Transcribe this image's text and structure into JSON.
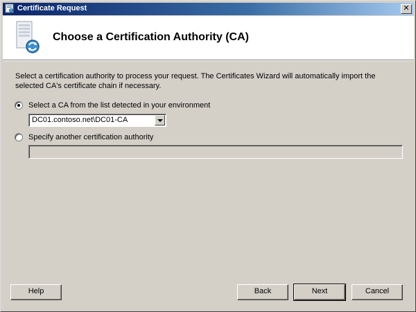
{
  "window": {
    "title": "Certificate Request",
    "close_glyph": "✕"
  },
  "header": {
    "title": "Choose a Certification Authority (CA)"
  },
  "intro_text": "Select a certification authority to process your request. The Certificates Wizard will automatically import the selected CA's certificate chain if necessary.",
  "options": {
    "detected": {
      "label": "Select a CA from the list detected in your environment",
      "selected": true,
      "ca_value": "DC01.contoso.net\\DC01-CA"
    },
    "other": {
      "label": "Specify another certification authority",
      "selected": false,
      "value": ""
    }
  },
  "buttons": {
    "help": "Help",
    "back": "Back",
    "next": "Next",
    "cancel": "Cancel"
  },
  "icons": {
    "app": "certificate-icon",
    "wizard": "server-certificate-icon"
  },
  "colors": {
    "titlebar_start": "#0a246a",
    "titlebar_end": "#a6caf0",
    "dialog_bg": "#d4d0c8"
  }
}
